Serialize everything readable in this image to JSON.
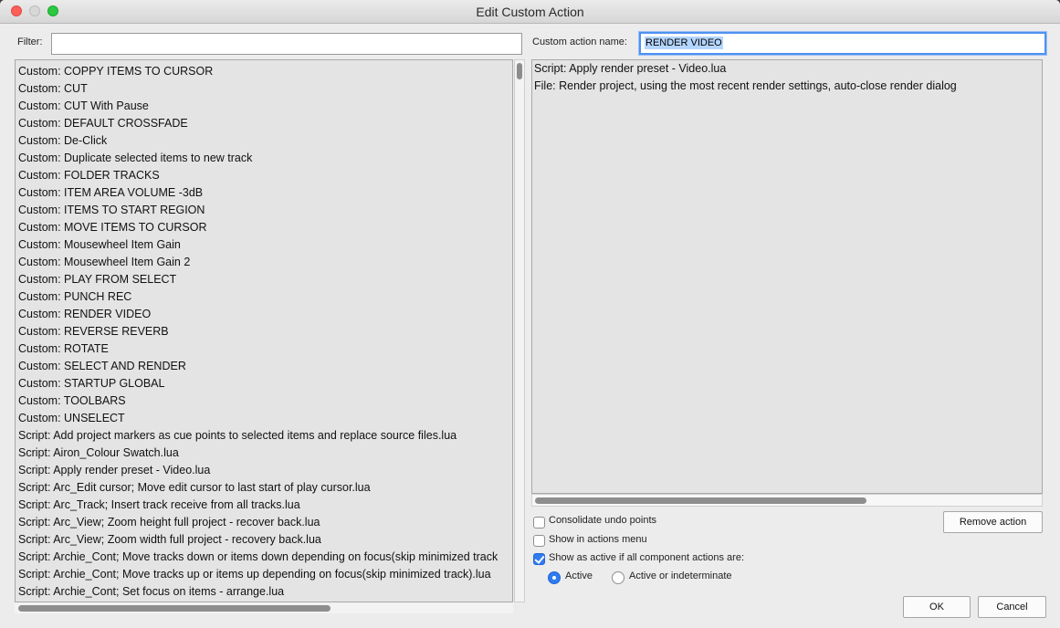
{
  "window": {
    "title": "Edit Custom Action"
  },
  "filter": {
    "label": "Filter:",
    "value": ""
  },
  "action_name": {
    "label": "Custom action name:",
    "value": "RENDER VIDEO"
  },
  "actions_list": [
    "Custom: COPPY ITEMS TO CURSOR",
    "Custom: CUT",
    "Custom: CUT With Pause",
    "Custom: DEFAULT CROSSFADE",
    "Custom: De-Click",
    "Custom: Duplicate selected items to new track",
    "Custom: FOLDER TRACKS",
    "Custom: ITEM AREA VOLUME -3dB",
    "Custom: ITEMS TO START REGION",
    "Custom: MOVE ITEMS TO CURSOR",
    "Custom: Mousewheel Item Gain",
    "Custom: Mousewheel Item Gain 2",
    "Custom: PLAY FROM SELECT",
    "Custom: PUNCH REC",
    "Custom: RENDER VIDEO",
    "Custom: REVERSE REVERB",
    "Custom: ROTATE",
    "Custom: SELECT AND RENDER",
    "Custom: STARTUP GLOBAL",
    "Custom: TOOLBARS",
    "Custom: UNSELECT",
    "Script: Add project markers as cue points to selected items and replace source files.lua",
    "Script: Airon_Colour Swatch.lua",
    "Script: Apply render preset - Video.lua",
    "Script: Arc_Edit cursor;  Move edit cursor to last start of play cursor.lua",
    "Script: Arc_Track;  Insert track receive from all tracks.lua",
    "Script: Arc_View;  Zoom height full project - recover back.lua",
    "Script: Arc_View;  Zoom width full project - recovery back.lua",
    "Script: Archie_Cont;  Move tracks down or items down depending on focus(skip minimized track",
    "Script: Archie_Cont;  Move tracks up or items up depending on focus(skip minimized track).lua",
    "Script: Archie_Cont;  Set focus on items - arrange.lua"
  ],
  "component_actions": [
    "Script: Apply render preset - Video.lua",
    "File: Render project, using the most recent render settings, auto-close render dialog"
  ],
  "options": {
    "consolidate_undo": {
      "label": "Consolidate undo points",
      "checked": false
    },
    "show_in_menu": {
      "label": "Show in actions menu",
      "checked": false
    },
    "show_as_active": {
      "label": "Show as active if all component actions are:",
      "checked": true
    }
  },
  "radio": {
    "active": "Active",
    "indeterminate": "Active or indeterminate",
    "selected": "Active"
  },
  "buttons": {
    "remove": "Remove action",
    "ok": "OK",
    "cancel": "Cancel"
  }
}
